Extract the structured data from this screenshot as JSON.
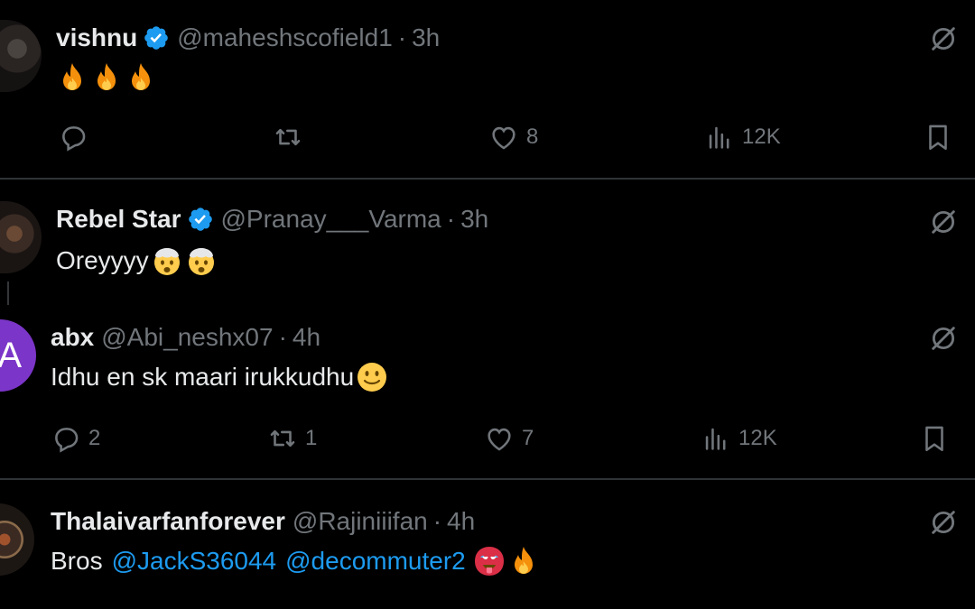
{
  "tweets": [
    {
      "name": "vishnu",
      "verified": true,
      "handle": "@maheshscofield1",
      "separator": "·",
      "time": "3h",
      "emojis": [
        "fire",
        "fire",
        "fire"
      ],
      "actions": {
        "replies": "",
        "reposts": "",
        "likes": "8",
        "views": "12K"
      }
    },
    {
      "name": "Rebel Star",
      "verified": true,
      "handle": "@Pranay___Varma",
      "separator": "·",
      "time": "3h",
      "text": "Oreyyyy",
      "emojis": [
        "exploding-head",
        "exploding-head"
      ]
    },
    {
      "name": "abx",
      "verified": false,
      "avatar_letter": "A",
      "handle": "@Abi_neshx07",
      "separator": "·",
      "time": "4h",
      "text": "Idhu en sk maari irukkudhu",
      "emojis": [
        "slightly-smiling-face"
      ],
      "actions": {
        "replies": "2",
        "reposts": "1",
        "likes": "7",
        "views": "12K"
      }
    },
    {
      "name": "Thalaivarfanforever",
      "verified": false,
      "handle": "@Rajiniiifan",
      "separator": "·",
      "time": "4h",
      "text_prefix": "Bros",
      "mentions": [
        "@JackS36044",
        "@decommuter2"
      ],
      "emojis": [
        "hot-face",
        "fire"
      ]
    }
  ],
  "colors": {
    "background": "#000000",
    "text": "#e7e9ea",
    "muted": "#71767b",
    "link": "#1d9bf0",
    "verified": "#1d9bf0",
    "avatar_abx": "#7b35c8"
  }
}
